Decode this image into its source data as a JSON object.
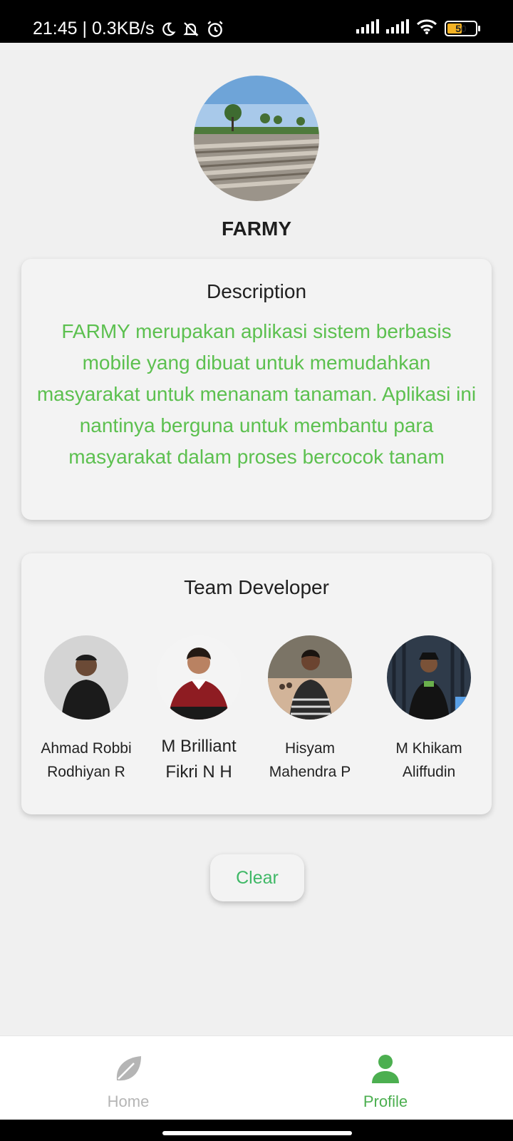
{
  "status_bar": {
    "time_speed": "21:45 | 0.3KB/s",
    "battery_level": "50",
    "icons": [
      "moon-icon",
      "bell-off-icon",
      "alarm-icon",
      "signal-icon",
      "signal-icon",
      "wifi-icon",
      "battery-icon"
    ]
  },
  "header": {
    "app_name": "FARMY"
  },
  "description": {
    "title": "Description",
    "text": "FARMY merupakan aplikasi sistem berbasis mobile yang dibuat untuk memudahkan masyarakat untuk menanam tanaman. Aplikasi ini nantinya berguna untuk membantu para masyarakat dalam proses bercocok tanam"
  },
  "team": {
    "title": "Team Developer",
    "members": [
      {
        "line1": "Ahmad Robbi",
        "line2": "Rodhiyan R"
      },
      {
        "line1": "M Brilliant",
        "line2": "Fikri N H"
      },
      {
        "line1": "Hisyam",
        "line2": "Mahendra P"
      },
      {
        "line1": "M Khikam",
        "line2": "Aliffudin"
      }
    ]
  },
  "actions": {
    "clear_label": "Clear"
  },
  "bottom_nav": {
    "items": [
      {
        "label": "Home",
        "icon": "leaf-icon",
        "active": false
      },
      {
        "label": "Profile",
        "icon": "person-icon",
        "active": true
      }
    ]
  },
  "colors": {
    "accent_green": "#5cc04f",
    "nav_active": "#4caf50",
    "nav_inactive": "#b5b5b5"
  }
}
